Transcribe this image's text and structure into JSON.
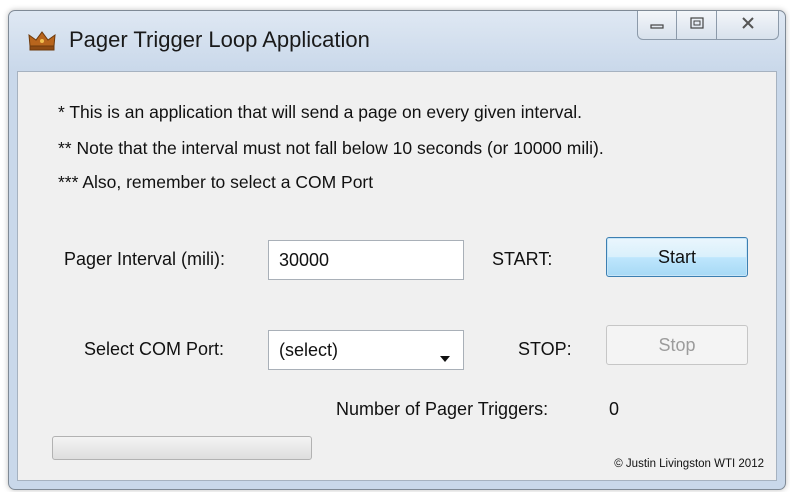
{
  "window": {
    "title": "Pager Trigger Loop Application"
  },
  "notes": [
    "* This is an application that will send a page on every given interval.",
    "** Note that the interval must not fall below 10 seconds (or 10000 mili).",
    "*** Also, remember to select a COM Port"
  ],
  "interval": {
    "label": "Pager Interval (mili):",
    "value": "30000"
  },
  "com_port": {
    "label": "Select COM Port:",
    "selected": "(select)"
  },
  "start": {
    "label": "START:",
    "button": "Start"
  },
  "stop": {
    "label": "STOP:",
    "button": "Stop"
  },
  "triggers": {
    "label": "Number of Pager Triggers:",
    "count": "0"
  },
  "progress": {
    "percent": 0
  },
  "copyright": "© Justin Livingston WTI 2012",
  "icons": {
    "app": "crown-icon",
    "minimize": "minimize-icon",
    "maximize": "maximize-icon",
    "close": "close-icon",
    "dropdown": "chevron-down-icon"
  },
  "colors": {
    "start_button_border": "#3c7fb1",
    "disabled_text": "#9c9c9c",
    "progress_fill": "#37b31e"
  }
}
